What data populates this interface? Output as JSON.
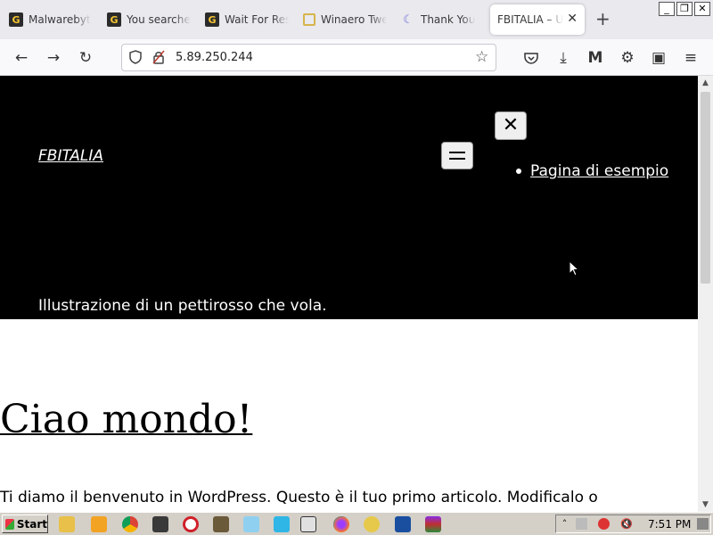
{
  "browser": {
    "tabs": [
      {
        "title": "Malwarebytes",
        "favicon": "g-favicon"
      },
      {
        "title": "You searched",
        "favicon": "g-favicon"
      },
      {
        "title": "Wait For Res",
        "favicon": "g-favicon"
      },
      {
        "title": "Winaero Twe",
        "favicon": "winaero-favicon"
      },
      {
        "title": "Thank You",
        "favicon": "thank-favicon"
      },
      {
        "title": "FBITALIA – Un",
        "favicon": "none",
        "active": true
      }
    ],
    "address": "5.89.250.244",
    "window_controls": {
      "minimize": "_",
      "restore": "❐",
      "close": "✕"
    }
  },
  "page": {
    "site_title": "FBITALIA",
    "menu_items": [
      "Pagina di esempio"
    ],
    "header_caption": "Illustrazione di un pettirosso che vola.",
    "post_title": "Ciao mondo!",
    "post_excerpt": "Ti diamo il benvenuto in WordPress. Questo è il tuo primo articolo. Modificalo o"
  },
  "taskbar": {
    "start_label": "Start",
    "clock": "7:51 PM"
  },
  "colors": {
    "header_bg": "#000000",
    "header_text": "#ffffff",
    "tabstrip_bg": "#e9e9ee",
    "taskbar_bg": "#d4d0c8"
  }
}
